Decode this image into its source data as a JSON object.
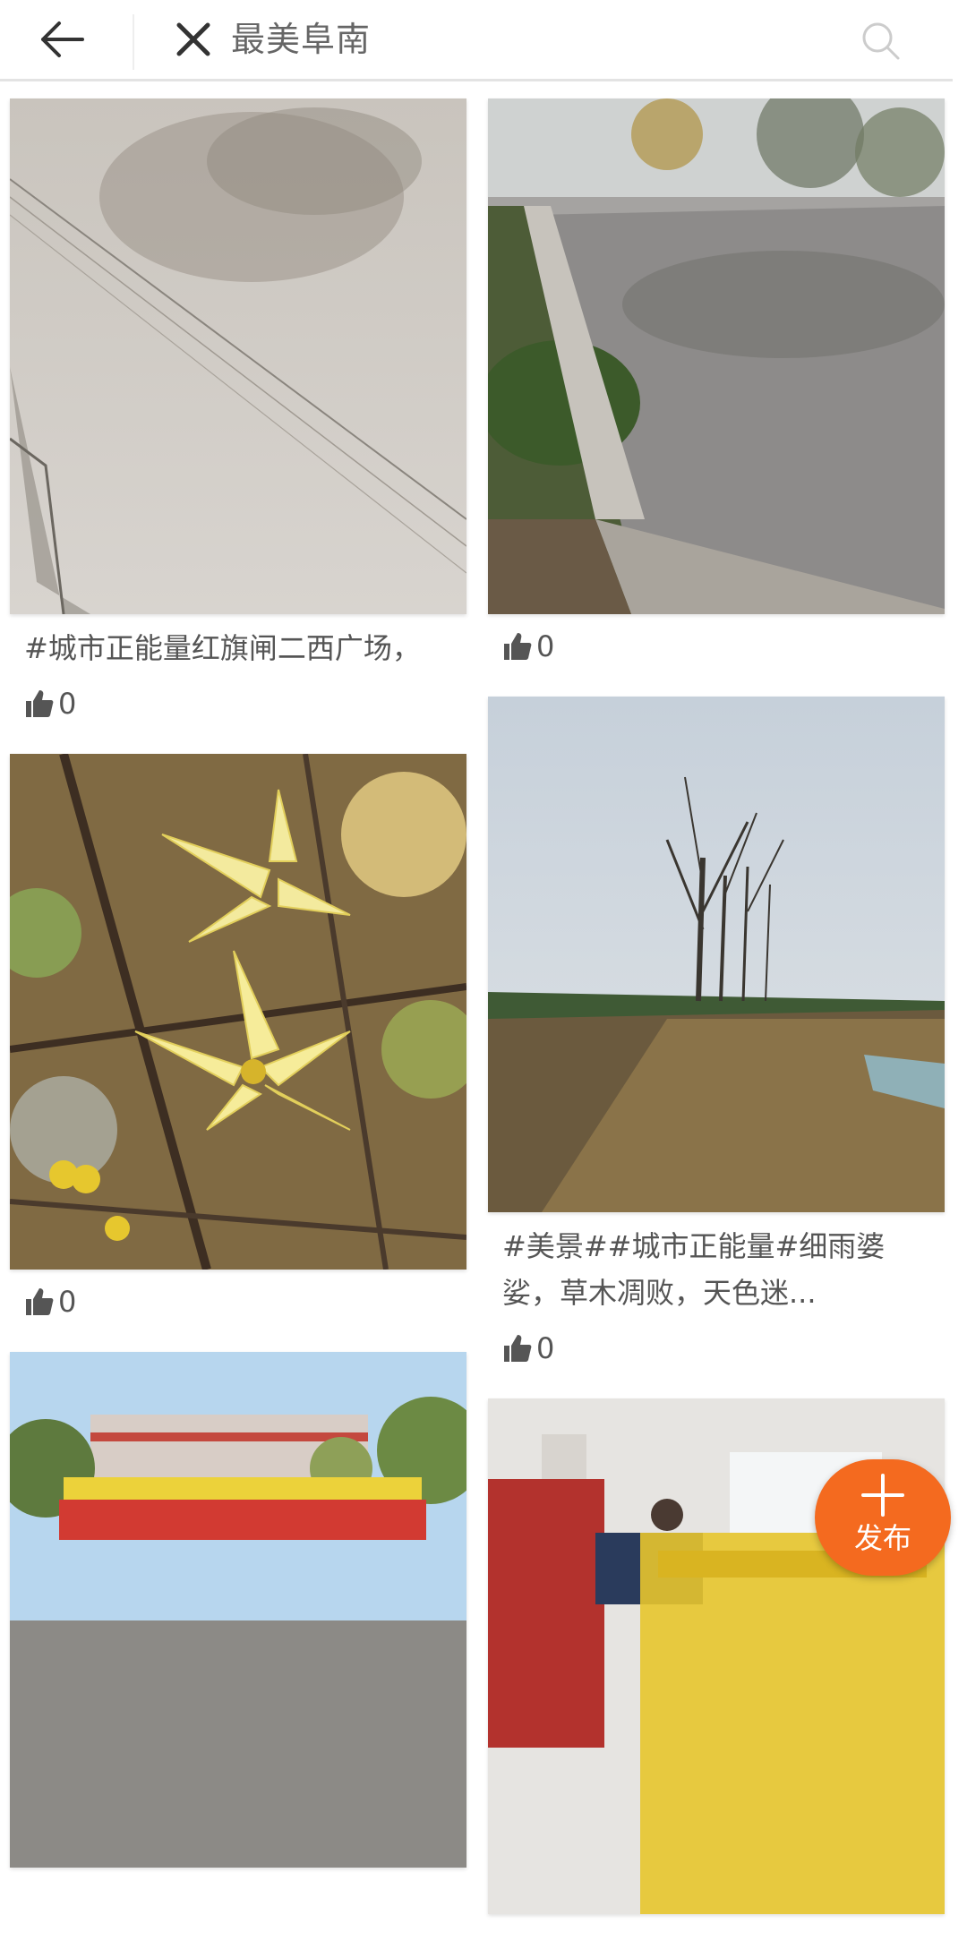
{
  "header": {
    "search_query": "最美阜南",
    "back_icon": "back-arrow-icon",
    "clear_icon": "close-icon",
    "search_icon": "search-icon"
  },
  "feed": {
    "left": [
      {
        "image": "reflection of trees in still water with wires",
        "caption": "#城市正能量红旗闸二西广场，",
        "likes": "0"
      },
      {
        "image": "yellow wintersweet flowers on bare branches",
        "caption": "",
        "likes": "0"
      },
      {
        "image": "group of children in yellow with red banner in front of school building",
        "caption": "",
        "likes": ""
      }
    ],
    "right": [
      {
        "image": "pond bordered by stone embankment with trees reflected",
        "caption": "",
        "likes": "0"
      },
      {
        "image": "foggy field with bare trees and dirt path",
        "caption": "#美景##城市正能量#细雨婆娑，草木凋败，天色迷...",
        "likes": "0"
      },
      {
        "image": "indoor classroom with children in yellow and adults",
        "caption": "",
        "likes": ""
      }
    ]
  },
  "fab": {
    "label": "发布",
    "icon": "plus-icon",
    "color": "#f46a1f"
  }
}
